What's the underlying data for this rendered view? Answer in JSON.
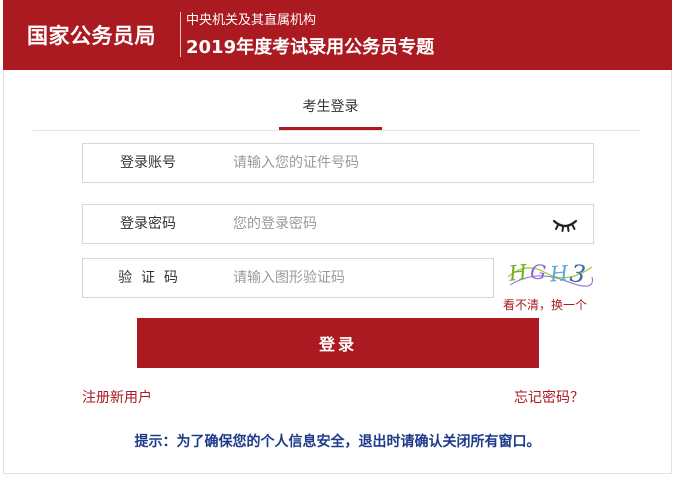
{
  "colors": {
    "brand": "#aa1a20",
    "notice": "#1e3a8a"
  },
  "header": {
    "org_name": "国家公务员局",
    "subtitle": "中央机关及其直属机构",
    "title": "2019年度考试录用公务员专题"
  },
  "tabs": [
    {
      "label": "考生登录",
      "active": true
    }
  ],
  "form": {
    "account": {
      "label": "登录账号",
      "placeholder": "请输入您的证件号码",
      "value": ""
    },
    "password": {
      "label": "登录密码",
      "placeholder": "您的登录密码",
      "value": "",
      "toggle_icon": "eye-closed-icon"
    },
    "captcha": {
      "label": "验  证  码",
      "placeholder": "请输入图形验证码",
      "value": "",
      "image_text": "HGH3",
      "refresh_text": "看不清，换一个"
    },
    "submit_label": "登录"
  },
  "links": {
    "register": "注册新用户",
    "forgot": "忘记密码？"
  },
  "notice": "提示：为了确保您的个人信息安全，退出时请确认关闭所有窗口。"
}
